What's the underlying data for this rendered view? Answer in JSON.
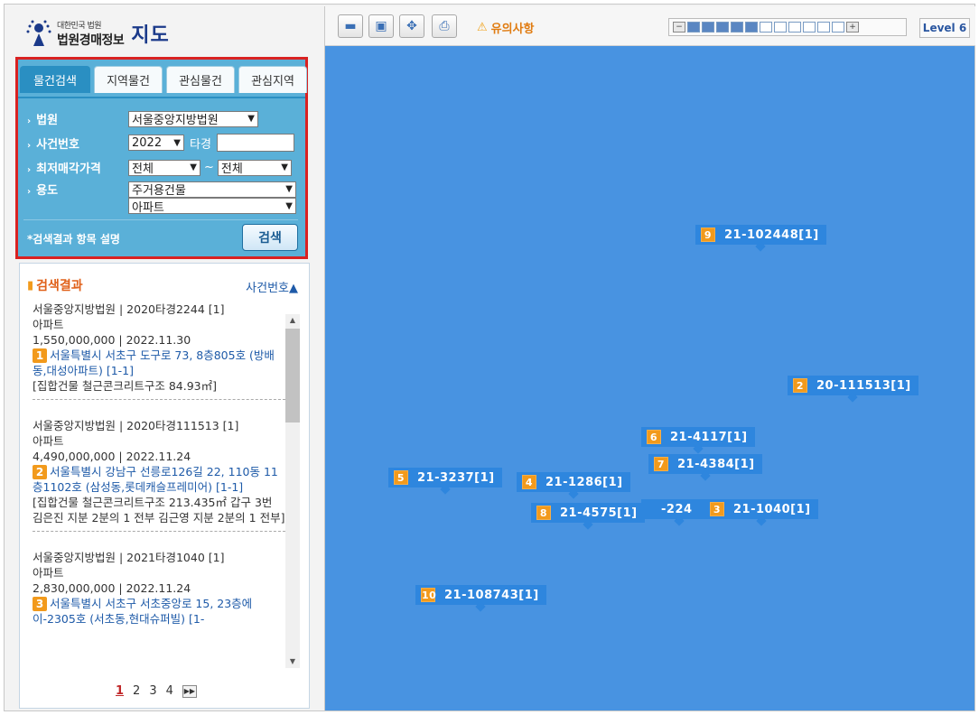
{
  "header": {
    "org_small": "대한민국 법원",
    "org_main": "법원경매정보",
    "title": "지도"
  },
  "tabs": [
    {
      "label": "물건검색",
      "active": true
    },
    {
      "label": "지역물건",
      "active": false
    },
    {
      "label": "관심물건",
      "active": false
    },
    {
      "label": "관심지역",
      "active": false
    }
  ],
  "search": {
    "court_label": "법원",
    "court_value": "서울중앙지방법원",
    "case_label": "사건번호",
    "case_year": "2022",
    "case_type": "타경",
    "case_number": "",
    "price_label": "최저매각가격",
    "price_min": "전체",
    "price_sep": "~",
    "price_max": "전체",
    "use_label": "용도",
    "use_value1": "주거용건물",
    "use_value2": "아파트",
    "note": "*검색결과 항목 설명",
    "button": "검색"
  },
  "results": {
    "title": "검색결과",
    "sort": "사건번호▲",
    "items": [
      {
        "line1": "서울중앙지방법원 | 2020타경2244 [1]",
        "line2": "아파트",
        "line3": "1,550,000,000 | 2022.11.30",
        "num": "1",
        "addr": "서울특별시 서초구 도구로 73, 8층805호 (방배동,대성아파트) [1-1]",
        "detail": "[집합건물 철근콘크리트구조 84.93㎡]"
      },
      {
        "line1": "서울중앙지방법원 | 2020타경111513 [1]",
        "line2": "아파트",
        "line3": "4,490,000,000 | 2022.11.24",
        "num": "2",
        "addr": "서울특별시 강남구 선릉로126길 22, 110동 11층1102호 (삼성동,롯데캐슬프레미어) [1-1]",
        "detail": "[집합건물 철근콘크리트구조 213.435㎡ 갑구 3번 김은진 지분 2분의 1 전부 김근영 지분 2분의 1 전부]"
      },
      {
        "line1": "서울중앙지방법원 | 2021타경1040 [1]",
        "line2": "아파트",
        "line3": "2,830,000,000 | 2022.11.24",
        "num": "3",
        "addr": "서울특별시 서초구 서초중앙로 15, 23층에이-2305호 (서초동,현대슈퍼빌) [1-",
        "detail": ""
      }
    ],
    "pages": [
      "1",
      "2",
      "3",
      "4"
    ]
  },
  "map": {
    "warning": "유의사항",
    "level": "Level 6",
    "zoom_filled": 5,
    "zoom_total": 11,
    "markers": [
      {
        "num": "9",
        "label": "21-102448[1]"
      },
      {
        "num": "2",
        "label": "20-111513[1]"
      },
      {
        "num": "6",
        "label": "21-4117[1]"
      },
      {
        "num": "7",
        "label": "21-4384[1]"
      },
      {
        "num": "5",
        "label": "21-3237[1]"
      },
      {
        "num": "4",
        "label": "21-1286[1]"
      },
      {
        "num": "8",
        "label": "21-4575[1]"
      },
      {
        "num": "3",
        "label": "21-1040[1]"
      },
      {
        "num": "10",
        "label": "21-108743[1]"
      }
    ],
    "partial_label": "-224"
  },
  "colors": {
    "map_bg": "#4893e1",
    "marker_bg": "#2e86de",
    "marker_num": "#f29a1c",
    "search_border": "#d92121",
    "search_bg": "#5ab0d8"
  }
}
